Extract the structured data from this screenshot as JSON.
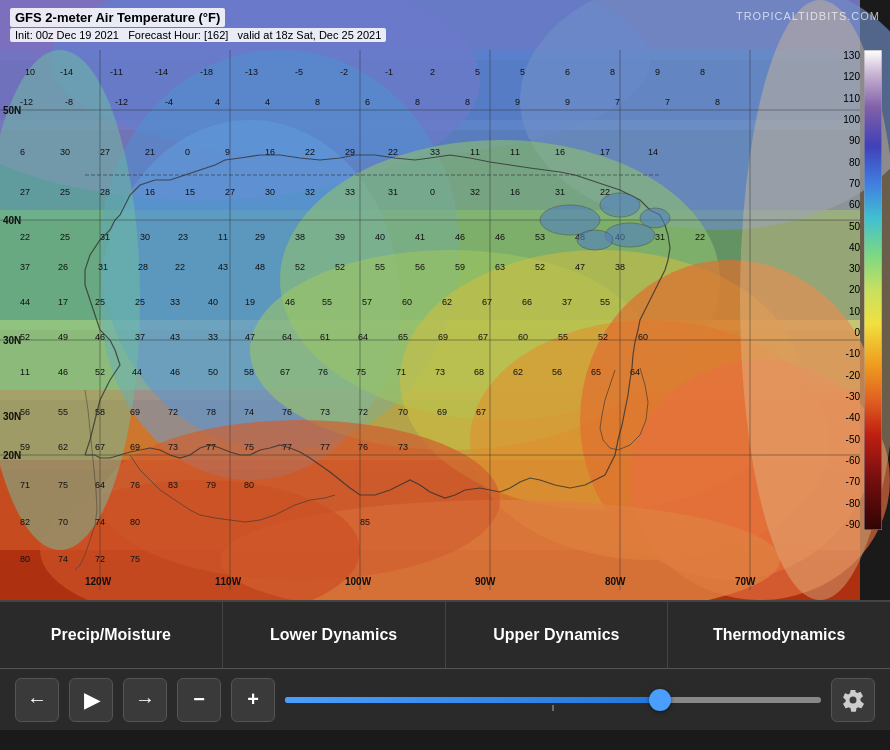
{
  "map": {
    "title": "GFS 2-meter Air Temperature (°F)",
    "subtitle_init": "Init: 00z Dec 19 2021",
    "subtitle_forecast": "Forecast Hour: [162]",
    "subtitle_valid": "valid at 18z Sat, Dec 25 2021",
    "brand": "TROPICALTIDBITS.COM"
  },
  "scale": {
    "values": [
      "130",
      "120",
      "110",
      "100",
      "90",
      "80",
      "70",
      "60",
      "50",
      "40",
      "30",
      "20",
      "10",
      "0",
      "-10",
      "-20",
      "-30",
      "-40",
      "-50",
      "-60",
      "-70",
      "-80",
      "-90"
    ]
  },
  "tabs": [
    {
      "label": "Precip/Moisture",
      "id": "precip"
    },
    {
      "label": "Lower Dynamics",
      "id": "lower"
    },
    {
      "label": "Upper Dynamics",
      "id": "upper"
    },
    {
      "label": "Thermodynamics",
      "id": "thermo"
    }
  ],
  "controls": {
    "back_label": "←",
    "play_label": "▶",
    "forward_label": "→",
    "minus_label": "−",
    "plus_label": "+",
    "slider_value": 70
  },
  "lat_labels": [
    "50N",
    "40N",
    "30N",
    "20N"
  ],
  "lon_labels": [
    "120W",
    "110W",
    "100W",
    "90W",
    "80W",
    "70W"
  ]
}
